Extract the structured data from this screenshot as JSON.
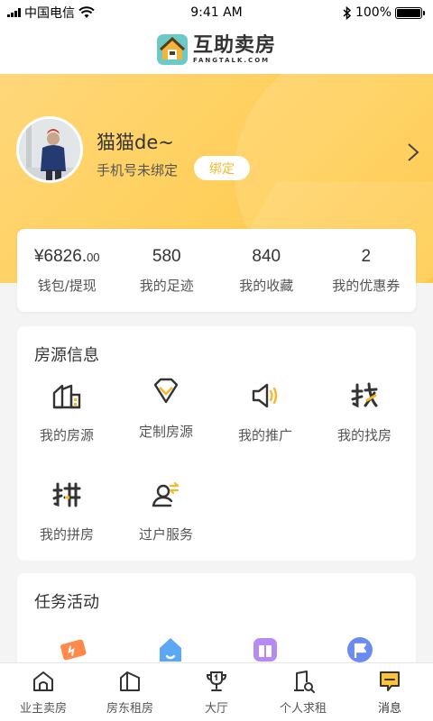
{
  "status_bar": {
    "carrier": "中国电信",
    "time": "9:41 AM",
    "battery": "100%"
  },
  "header": {
    "logo_title": "互助卖房",
    "logo_subtitle": "FANGTALK.COM"
  },
  "profile": {
    "username": "猫猫de~",
    "phone_note": "手机号未绑定",
    "bind_label": "绑定"
  },
  "stats": [
    {
      "value": "¥6826.",
      "value_small": "00",
      "label": "钱包/提现"
    },
    {
      "value": "580",
      "value_small": "",
      "label": "我的足迹"
    },
    {
      "value": "840",
      "value_small": "",
      "label": "我的收藏"
    },
    {
      "value": "2",
      "value_small": "",
      "label": "我的优惠券"
    }
  ],
  "housing_section": {
    "title": "房源信息",
    "items": [
      {
        "label": "我的房源",
        "icon": "building-icon"
      },
      {
        "label": "定制房源",
        "icon": "diamond-icon"
      },
      {
        "label": "我的推广",
        "icon": "megaphone-icon"
      },
      {
        "label": "我的找房",
        "icon": "find-icon"
      },
      {
        "label": "我的拼房",
        "icon": "pin-icon"
      },
      {
        "label": "过户服务",
        "icon": "transfer-person-icon"
      }
    ]
  },
  "task_section": {
    "title": "任务活动",
    "icons": [
      "ticket-icon",
      "home-icon",
      "gift-icon",
      "flag-icon"
    ]
  },
  "tab_bar": {
    "items": [
      {
        "label": "业主卖房",
        "icon": "house-icon"
      },
      {
        "label": "房东租房",
        "icon": "house-outline-icon"
      },
      {
        "label": "大厅",
        "icon": "trophy-icon"
      },
      {
        "label": "个人求租",
        "icon": "door-search-icon"
      },
      {
        "label": "消息",
        "icon": "message-icon",
        "active": true
      }
    ]
  },
  "colors": {
    "accent": "#ffc436",
    "accent_light": "#ffd77a",
    "text": "#333333"
  }
}
